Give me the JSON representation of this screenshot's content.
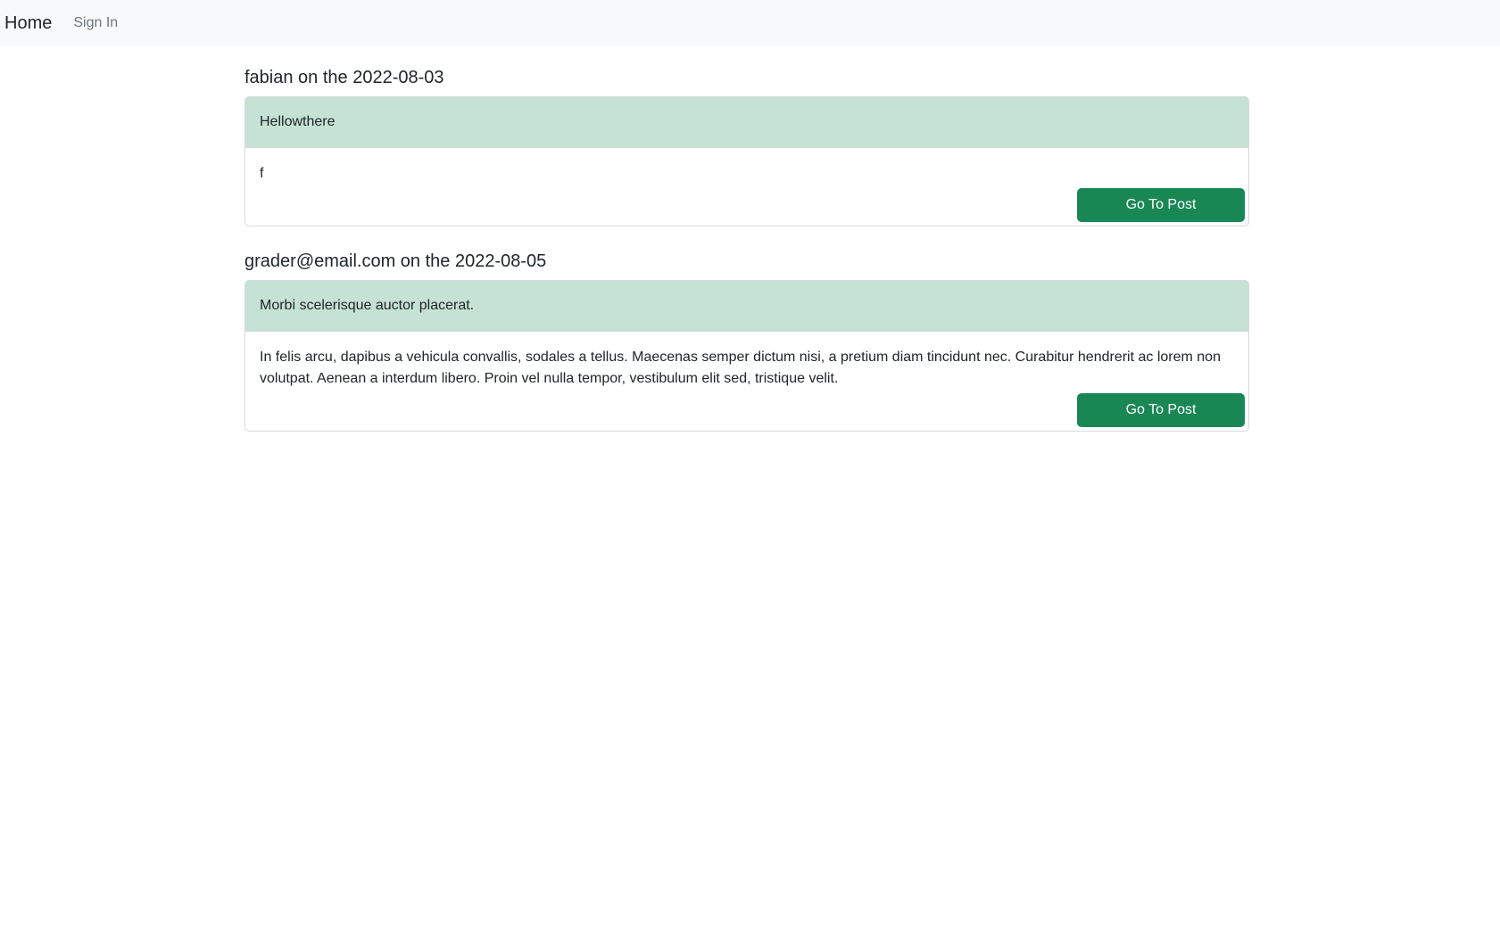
{
  "nav": {
    "brand": "Home",
    "sign_in": "Sign In"
  },
  "posts": [
    {
      "heading": "fabian on the 2022-08-03",
      "title": "Hellowthere",
      "body": "f",
      "button": "Go To Post"
    },
    {
      "heading": "grader@email.com on the 2022-08-05",
      "title": "Morbi scelerisque auctor placerat.",
      "body": "In felis arcu, dapibus a vehicula convallis, sodales a tellus. Maecenas semper dictum nisi, a pretium diam tincidunt nec. Curabitur hendrerit ac lorem non volutpat. Aenean a interdum libero. Proin vel nulla tempor, vestibulum elit sed, tristique velit.",
      "button": "Go To Post"
    }
  ],
  "colors": {
    "navbar_bg": "#f8f9fa",
    "card_header_bg": "#c5e2d4",
    "button_bg": "#198754"
  }
}
